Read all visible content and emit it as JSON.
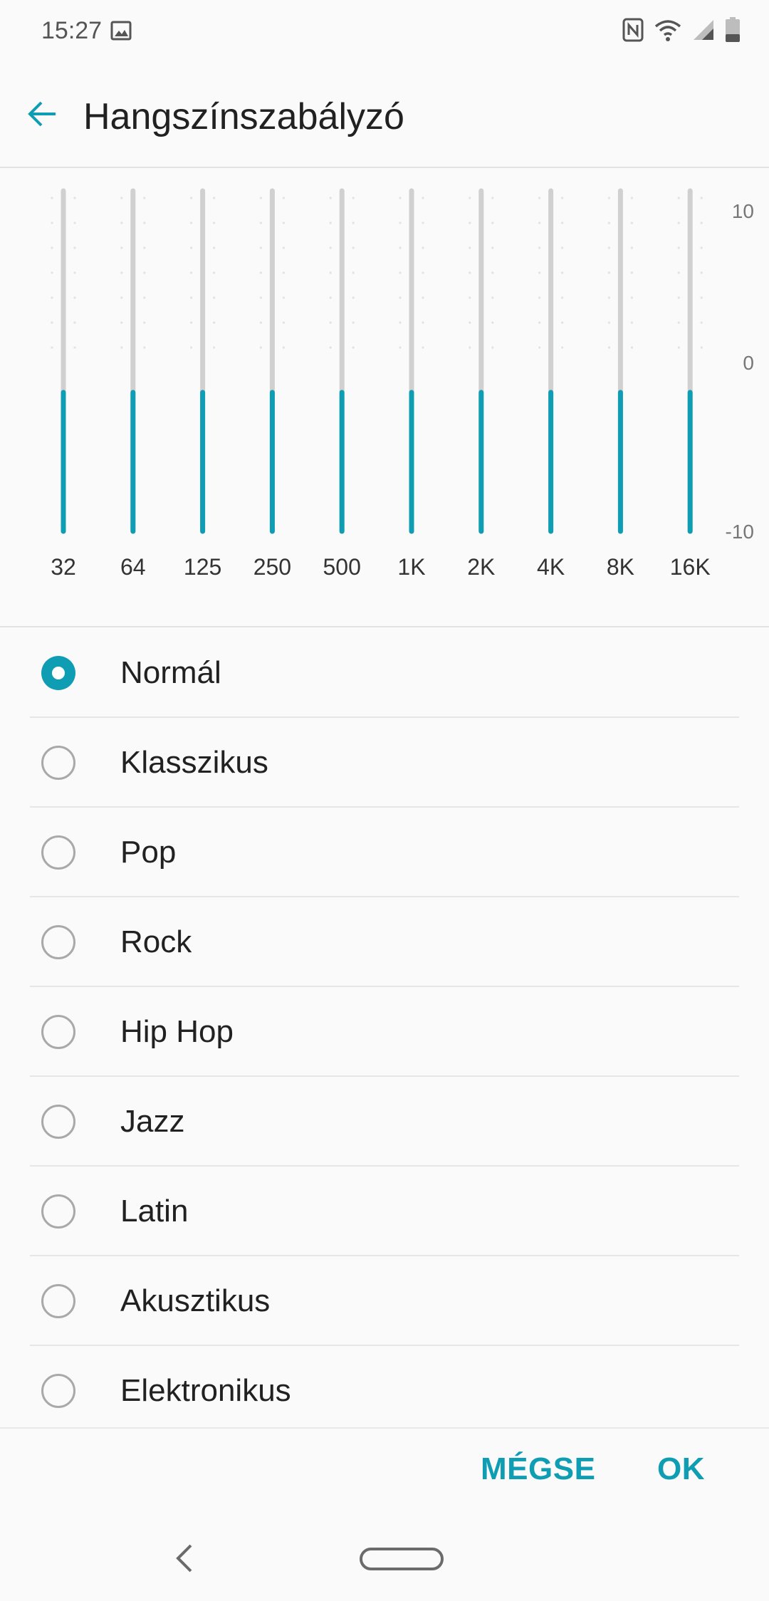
{
  "status_bar": {
    "time": "15:27",
    "icons": [
      "gallery-icon",
      "nfc-icon",
      "wifi-icon",
      "cellular-signal-icon",
      "battery-icon"
    ]
  },
  "header": {
    "title": "Hangszínszabályzó",
    "back_icon": "arrow-left-icon"
  },
  "equalizer": {
    "accent_color": "#0e9db2",
    "track_color": "#d0d0d0",
    "db_labels": [
      "10",
      "0",
      "-10"
    ],
    "db_range": [
      -10,
      10
    ],
    "bands": [
      {
        "label": "32",
        "value": 0
      },
      {
        "label": "64",
        "value": 0
      },
      {
        "label": "125",
        "value": 0
      },
      {
        "label": "250",
        "value": 0
      },
      {
        "label": "500",
        "value": 0
      },
      {
        "label": "1K",
        "value": 0
      },
      {
        "label": "2K",
        "value": 0
      },
      {
        "label": "4K",
        "value": 0
      },
      {
        "label": "8K",
        "value": 0
      },
      {
        "label": "16K",
        "value": 0
      }
    ]
  },
  "presets": {
    "selected": "Normál",
    "items": [
      {
        "label": "Normál",
        "checked": true
      },
      {
        "label": "Klasszikus",
        "checked": false
      },
      {
        "label": "Pop",
        "checked": false
      },
      {
        "label": "Rock",
        "checked": false
      },
      {
        "label": "Hip Hop",
        "checked": false
      },
      {
        "label": "Jazz",
        "checked": false
      },
      {
        "label": "Latin",
        "checked": false
      },
      {
        "label": "Akusztikus",
        "checked": false
      },
      {
        "label": "Elektronikus",
        "checked": false
      }
    ]
  },
  "buttons": {
    "cancel": "MÉGSE",
    "ok": "OK"
  },
  "nav_bar": {
    "icons": [
      "nav-back-icon",
      "nav-home-icon"
    ]
  }
}
